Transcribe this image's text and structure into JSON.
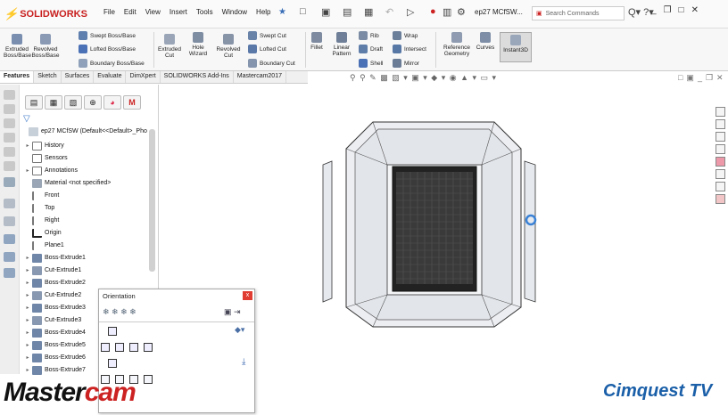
{
  "app": {
    "logo": "SOLIDWORKS",
    "file_name": "ep27 MCfSW..."
  },
  "menus": [
    "File",
    "Edit",
    "View",
    "Insert",
    "Tools",
    "Window",
    "Help"
  ],
  "search": {
    "placeholder": "Search Commands"
  },
  "ribbon": {
    "extruded_boss": "Extruded Boss/Base",
    "revolved_boss": "Revolved Boss/Base",
    "swept_boss": "Swept Boss/Base",
    "lofted_boss": "Lofted Boss/Base",
    "boundary_boss": "Boundary Boss/Base",
    "extruded_cut": "Extruded Cut",
    "hole_wizard": "Hole Wizard",
    "revolved_cut": "Revolved Cut",
    "swept_cut": "Swept Cut",
    "lofted_cut": "Lofted Cut",
    "boundary_cut": "Boundary Cut",
    "fillet": "Fillet",
    "linear_pattern": "Linear Pattern",
    "rib": "Rib",
    "draft": "Draft",
    "shell": "Shell",
    "wrap": "Wrap",
    "intersect": "Intersect",
    "mirror": "Mirror",
    "reference_geometry": "Reference Geometry",
    "curves": "Curves",
    "instant3d": "Instant3D"
  },
  "tabs": [
    "Features",
    "Sketch",
    "Surfaces",
    "Evaluate",
    "DimXpert",
    "SOLIDWORKS Add-Ins",
    "Mastercam2017"
  ],
  "tree": {
    "root": "ep27 MCfSW  (Default<<Default>_Pho",
    "items": [
      "History",
      "Sensors",
      "Annotations",
      "Material <not specified>",
      "Front",
      "Top",
      "Right",
      "Origin",
      "Plane1",
      "Boss-Extrude1",
      "Cut-Extrude1",
      "Boss-Extrude2",
      "Cut-Extrude2",
      "Boss-Extrude3",
      "Cut-Extrude3",
      "Boss-Extrude4",
      "Boss-Extrude5",
      "Boss-Extrude6",
      "Boss-Extrude7"
    ]
  },
  "orientation": {
    "title": "Orientation",
    "close": "x"
  },
  "watermarks": {
    "left_a": "Master",
    "left_b": "cam",
    "right": "Cimquest TV"
  },
  "colors": {
    "accent": "#3a6fb7",
    "logo_red": "#c8201f",
    "close_red": "#e03c31"
  }
}
